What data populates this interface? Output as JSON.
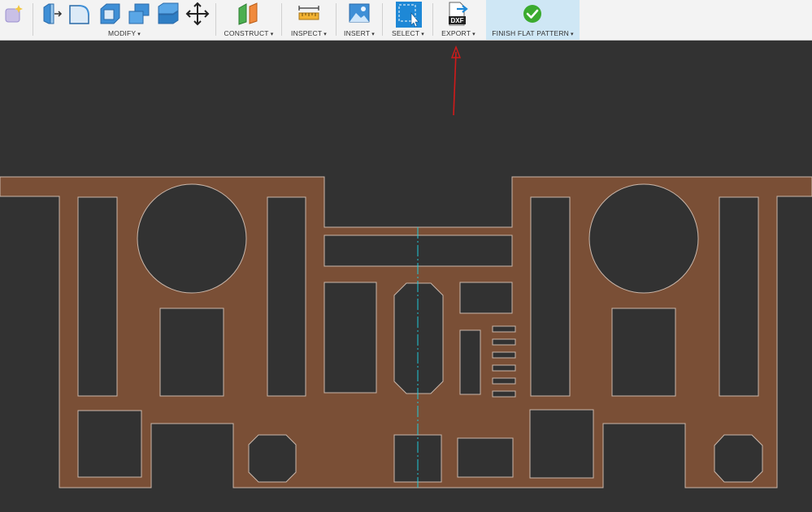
{
  "toolbar": {
    "groups": [
      {
        "id": "modify",
        "label": "MODIFY"
      },
      {
        "id": "construct",
        "label": "CONSTRUCT"
      },
      {
        "id": "inspect",
        "label": "INSPECT"
      },
      {
        "id": "insert",
        "label": "INSERT"
      },
      {
        "id": "select",
        "label": "SELECT"
      },
      {
        "id": "export",
        "label": "EXPORT"
      },
      {
        "id": "finish",
        "label": "FINISH FLAT PATTERN"
      }
    ],
    "export_icon_text": "DXF",
    "caret": "▾"
  },
  "colors": {
    "toolbar_bg": "#f3f3f3",
    "canvas_bg": "#323232",
    "part_fill": "#7a4f36",
    "part_edge": "#c9b7ab",
    "centerline": "#20c8d8",
    "annotation_arrow": "#d11a1a",
    "finish_highlight": "#cfe7f5",
    "finish_check": "#3bab2f"
  },
  "icons": [
    "sketch-sparkle-icon",
    "press-pull-icon",
    "fillet-icon",
    "shell-icon",
    "combine-icon",
    "split-body-icon",
    "move-icon",
    "offset-plane-icon",
    "measure-icon",
    "insert-image-icon",
    "window-select-icon",
    "export-dxf-icon",
    "finish-check-icon"
  ]
}
